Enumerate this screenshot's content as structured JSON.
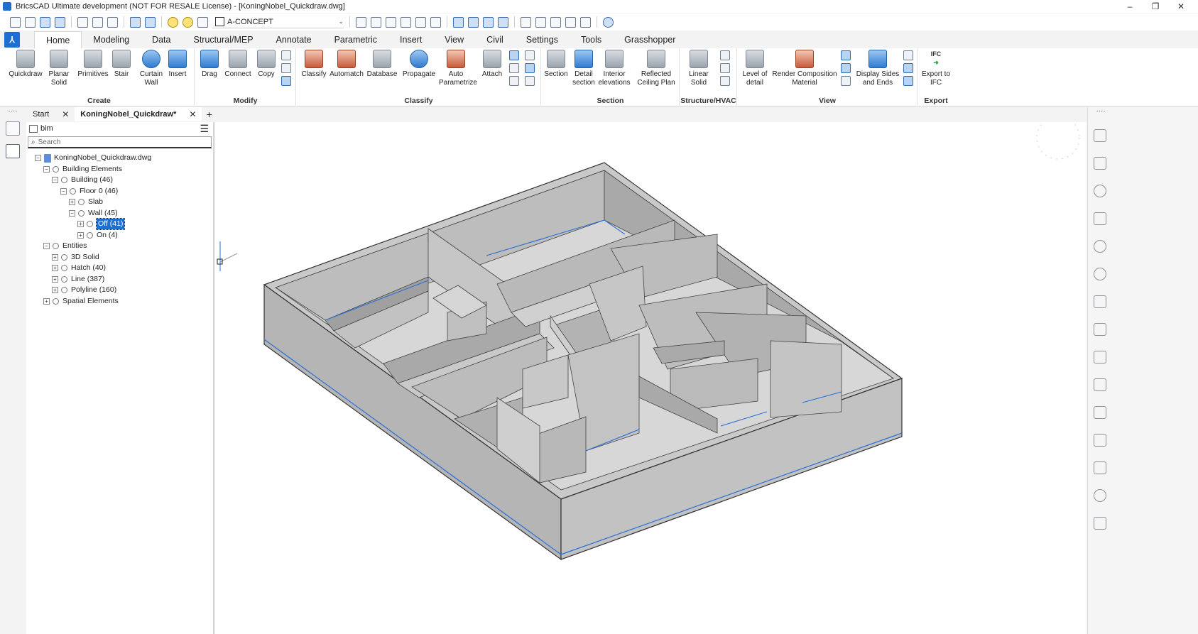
{
  "titlebar": {
    "title": "BricsCAD Ultimate development (NOT FOR RESALE License) - [KoningNobel_Quickdraw.dwg]",
    "minimize": "–",
    "restore": "❐",
    "close": "✕"
  },
  "qat": {
    "layer": "A-CONCEPT",
    "caret": "⌄"
  },
  "ribbon": {
    "brand": "⅄",
    "tabs": [
      "Home",
      "Modeling",
      "Data",
      "Structural/MEP",
      "Annotate",
      "Parametric",
      "Insert",
      "View",
      "Civil",
      "Settings",
      "Tools",
      "Grasshopper"
    ],
    "panels": {
      "create": {
        "title": "Create",
        "buttons": [
          "Quickdraw",
          "Planar Solid",
          "Primitives",
          "Stair",
          "Curtain Wall",
          "Insert"
        ]
      },
      "modify": {
        "title": "Modify",
        "buttons": [
          "Drag",
          "Connect",
          "Copy"
        ]
      },
      "classify": {
        "title": "Classify",
        "buttons": [
          "Classify",
          "Automatch",
          "Database",
          "Propagate",
          "Auto Parametrize",
          "Attach"
        ]
      },
      "section": {
        "title": "Section",
        "buttons": [
          "Section",
          "Detail section",
          "Interior elevations",
          "Reflected Ceiling Plan"
        ]
      },
      "structure": {
        "title": "Structure/HVAC",
        "buttons": [
          "Linear Solid"
        ]
      },
      "view": {
        "title": "View",
        "buttons": [
          "Level of detail",
          "Render Composition Material",
          "Display Sides and Ends"
        ]
      },
      "export": {
        "title": "Export",
        "buttons": [
          "Export to IFC"
        ],
        "badge": "IFC"
      }
    }
  },
  "doc_tabs": {
    "handle": "····",
    "tabs": [
      {
        "label": "Start",
        "close": "✕"
      },
      {
        "label": "KoningNobel_Quickdraw*",
        "close": "✕"
      }
    ],
    "plus": "+"
  },
  "structure": {
    "root": "bim",
    "menu": "☰",
    "search_placeholder": "Search",
    "tree": [
      {
        "label": "KoningNobel_Quickdraw.dwg",
        "level": 0,
        "exp": "−",
        "type": "doc"
      },
      {
        "label": "Building Elements",
        "level": 1,
        "exp": "−"
      },
      {
        "label": "Building (46)",
        "level": 2,
        "exp": "−"
      },
      {
        "label": "Floor 0 (46)",
        "level": 3,
        "exp": "−"
      },
      {
        "label": "Slab",
        "level": 4,
        "exp": "+"
      },
      {
        "label": "Wall (45)",
        "level": 4,
        "exp": "−"
      },
      {
        "label": "Off (41)",
        "level": 5,
        "exp": "+",
        "selected": true
      },
      {
        "label": "On (4)",
        "level": 5,
        "exp": "+"
      },
      {
        "label": "Entities",
        "level": 1,
        "exp": "−"
      },
      {
        "label": "3D Solid",
        "level": 2,
        "exp": "+"
      },
      {
        "label": "Hatch (40)",
        "level": 2,
        "exp": "+"
      },
      {
        "label": "Line (387)",
        "level": 2,
        "exp": "+"
      },
      {
        "label": "Polyline (160)",
        "level": 2,
        "exp": "+"
      },
      {
        "label": "Spatial Elements",
        "level": 1,
        "exp": "+"
      }
    ]
  }
}
